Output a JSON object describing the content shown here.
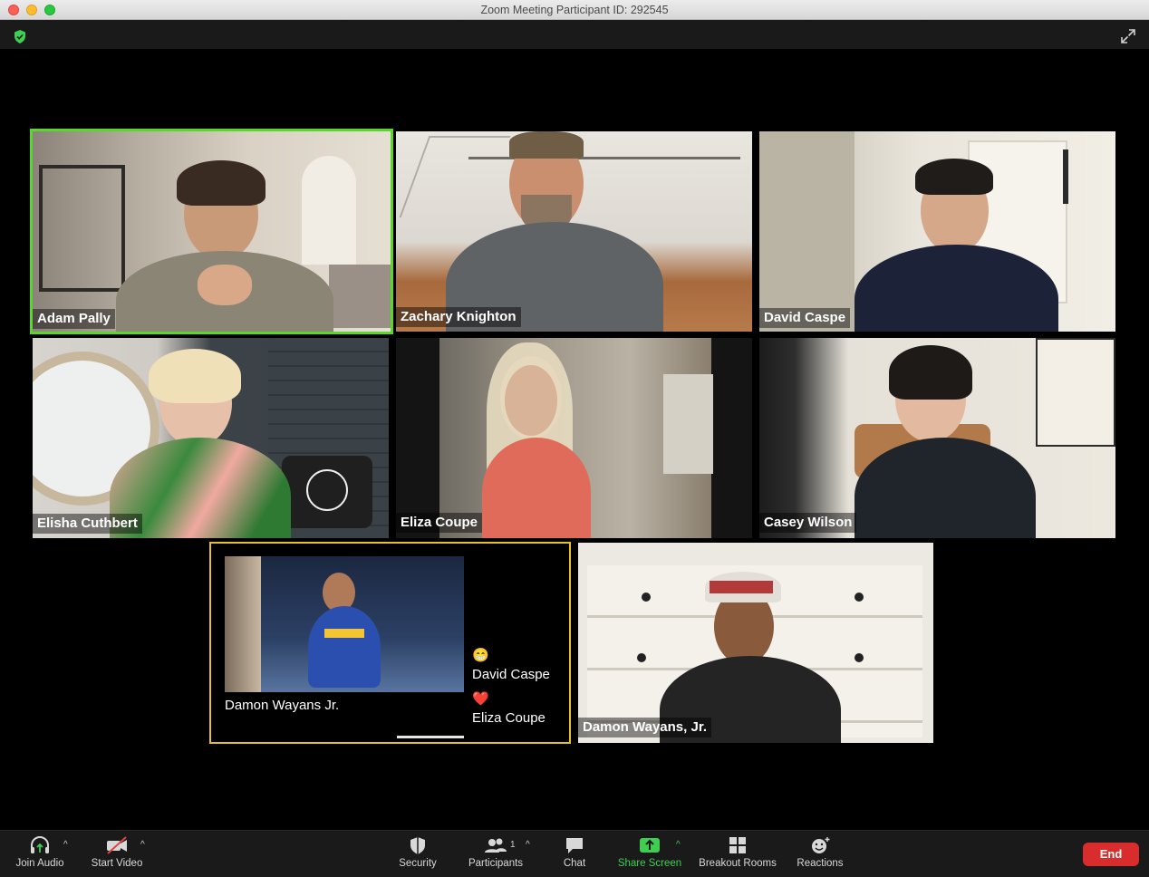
{
  "window": {
    "title": "Zoom Meeting Participant ID: 292545"
  },
  "participants": [
    {
      "name": "Adam Pally",
      "active_speaker": true
    },
    {
      "name": "Zachary Knighton",
      "active_speaker": false
    },
    {
      "name": "David Caspe",
      "active_speaker": false
    },
    {
      "name": "Elisha Cuthbert",
      "active_speaker": false
    },
    {
      "name": "Eliza Coupe",
      "active_speaker": false
    },
    {
      "name": "Casey Wilson",
      "active_speaker": false
    },
    {
      "name": "Damon Wayans, Jr.",
      "active_speaker": false
    }
  ],
  "reaction_panel": {
    "video_label": "Damon Wayans Jr.",
    "reactions": [
      {
        "emoji": "😁",
        "name": "David Caspe"
      },
      {
        "emoji": "❤️",
        "name": "Eliza Coupe"
      }
    ]
  },
  "toolbar": {
    "join_audio": "Join Audio",
    "start_video": "Start Video",
    "security": "Security",
    "participants": "Participants",
    "participants_count": "1",
    "chat": "Chat",
    "share_screen": "Share Screen",
    "breakout_rooms": "Breakout Rooms",
    "reactions": "Reactions",
    "end": "End"
  },
  "colors": {
    "active_speaker_border": "#5bd62a",
    "highlight_border": "#e6c12b",
    "share_green": "#3ecf52",
    "end_red": "#d92d2d"
  }
}
